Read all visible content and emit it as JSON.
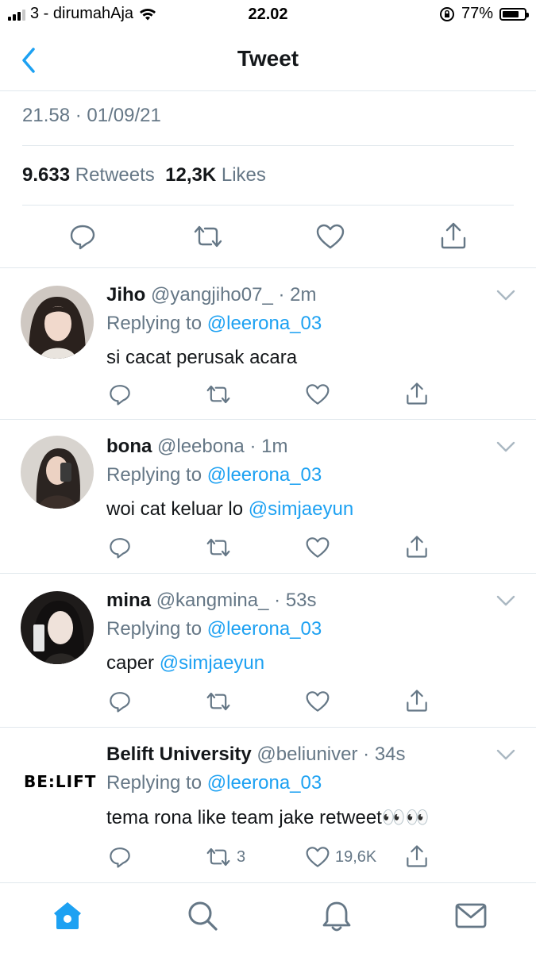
{
  "status_bar": {
    "carrier": "3 - dirumahAja",
    "time": "22.02",
    "battery": "77%",
    "battery_level": 0.77
  },
  "nav": {
    "title": "Tweet",
    "back_icon": "back-chevron-icon"
  },
  "tweet": {
    "timestamp": "21.58 · 01/09/21",
    "retweet_count": "9.633",
    "retweet_label": "Retweets",
    "like_count": "12,3K",
    "like_label": "Likes"
  },
  "replies": [
    {
      "name": "Jiho",
      "handle": "@yangjiho07_",
      "ago": "2m",
      "replying_label": "Replying to",
      "replying_to": "@leerona_03",
      "text": "si cacat perusak acara",
      "mention": "",
      "retweets": "",
      "likes": ""
    },
    {
      "name": "bona",
      "handle": "@leebona",
      "ago": "1m",
      "replying_label": "Replying to",
      "replying_to": "@leerona_03",
      "text": "woi cat keluar lo ",
      "mention": "@simjaeyun",
      "retweets": "",
      "likes": ""
    },
    {
      "name": "mina",
      "handle": "@kangmina_",
      "ago": "53s",
      "replying_label": "Replying to",
      "replying_to": "@leerona_03",
      "text": "caper ",
      "mention": "@simjaeyun",
      "retweets": "",
      "likes": ""
    },
    {
      "name": "Belift University",
      "handle": "@beliuniver",
      "ago": "34s",
      "replying_label": "Replying to",
      "replying_to": "@leerona_03",
      "text": "tema rona like team jake retweet👀👀",
      "mention": "",
      "retweets": "3",
      "likes": "19,6K",
      "logo_text": "BE:LIFT"
    }
  ],
  "tabbar": {
    "items": [
      "home-icon",
      "search-icon",
      "notifications-icon",
      "messages-icon"
    ],
    "active": "home-icon"
  },
  "colors": {
    "accent": "#1da1f2",
    "secondary_text": "#657786",
    "divider": "#e1e8ed"
  }
}
